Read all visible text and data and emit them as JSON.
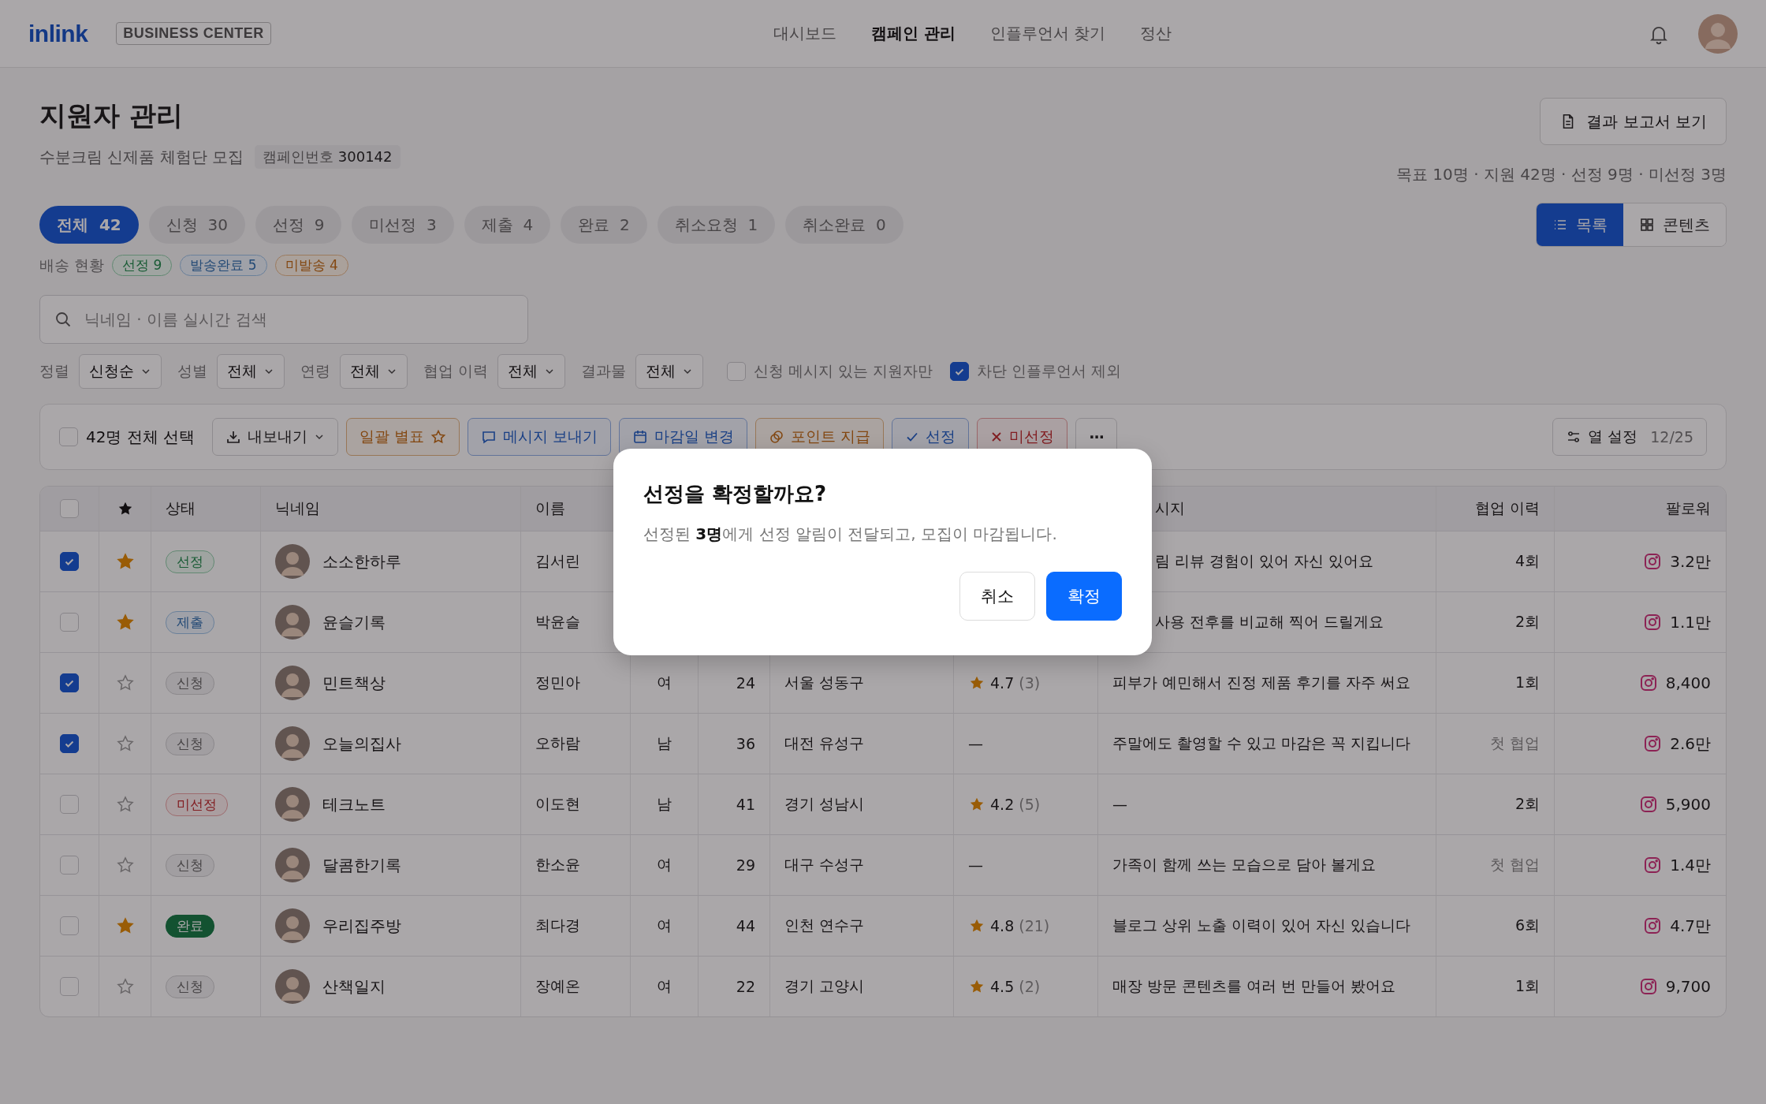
{
  "nav": {
    "logo": "inlink",
    "badge": "BUSINESS CENTER",
    "items": [
      {
        "label": "대시보드",
        "selected": false
      },
      {
        "label": "캠페인 관리",
        "selected": true
      },
      {
        "label": "인플루언서 찾기",
        "selected": false
      },
      {
        "label": "정산",
        "selected": false
      }
    ]
  },
  "header": {
    "title": "지원자 관리",
    "subtitle": "수분크림 신제품 체험단 모집",
    "campaign_tag": "캠페인번호 **300142**",
    "report_button": "결과 보고서 보기",
    "summary": "목표 10명 · 지원 42명 · 선정 9명 · 미선정 3명"
  },
  "tabs": [
    {
      "label": "전체",
      "count": "42",
      "selected": true
    },
    {
      "label": "신청",
      "count": "30",
      "selected": false
    },
    {
      "label": "선정",
      "count": "9",
      "selected": false
    },
    {
      "label": "미선정",
      "count": "3",
      "selected": false
    },
    {
      "label": "제출",
      "count": "4",
      "selected": false
    },
    {
      "label": "완료",
      "count": "2",
      "selected": false
    },
    {
      "label": "취소요청",
      "count": "1",
      "selected": false
    },
    {
      "label": "취소완료",
      "count": "0",
      "selected": false
    }
  ],
  "view_toggle": [
    {
      "label": "목록",
      "selected": true
    },
    {
      "label": "콘텐츠",
      "selected": false
    }
  ],
  "delivery": {
    "label": "배송 현황",
    "tags": [
      {
        "label": "선정 9",
        "kind": "selected"
      },
      {
        "label": "발송완료 5",
        "kind": "shipped"
      },
      {
        "label": "미발송 4",
        "kind": "pending"
      }
    ]
  },
  "search": {
    "placeholder": "닉네임 · 이름 실시간 검색"
  },
  "filters": [
    {
      "label": "정렬",
      "value": "신청순"
    },
    {
      "label": "성별",
      "value": "전체"
    },
    {
      "label": "연령",
      "value": "전체"
    },
    {
      "label": "협업 이력",
      "value": "전체"
    },
    {
      "label": "결과물",
      "value": "전체"
    }
  ],
  "filter_checks": [
    {
      "label": "신청 메시지 있는 지원자만",
      "checked": false
    },
    {
      "label": "차단 인플루언서 제외",
      "checked": true
    }
  ],
  "toolbar": {
    "select_all": {
      "label": "42명 전체 선택",
      "checked": false
    },
    "actions": [
      {
        "label": "내보내기",
        "kind": "neutral"
      },
      {
        "label": "일괄 별표",
        "kind": "warn"
      },
      {
        "label": "메시지 보내기",
        "kind": "primary"
      },
      {
        "label": "마감일 변경",
        "kind": "primary"
      },
      {
        "label": "포인트 지급",
        "kind": "warn"
      },
      {
        "label": "선정",
        "kind": "primary"
      },
      {
        "label": "미선정",
        "kind": "danger"
      },
      {
        "label": "···",
        "kind": "neutral"
      }
    ],
    "columns_button": {
      "label": "열 설정",
      "count": "12/25"
    }
  },
  "table": {
    "header": {
      "checked": false,
      "status": "상태",
      "nickname": "닉네임",
      "name": "이름",
      "message": "시지",
      "collab": "협업 이력",
      "followers": "팔로워"
    },
    "rows": [
      {
        "checked": true,
        "starred": true,
        "status": {
          "label": "선정",
          "kind": "selected"
        },
        "nickname": "소소한하루",
        "name": "김서린",
        "covered": true,
        "message": "림 리뷰 경험이 있어 자신 있어요",
        "collab": {
          "text": "4회",
          "muted": false
        },
        "followers": "3.2만"
      },
      {
        "checked": false,
        "starred": true,
        "status": {
          "label": "제출",
          "kind": "submitted"
        },
        "nickname": "윤슬기록",
        "name": "박윤슬",
        "covered": true,
        "message": "사용 전후를 비교해 찍어 드릴게요",
        "collab": {
          "text": "2회",
          "muted": false
        },
        "followers": "1.1만"
      },
      {
        "checked": true,
        "starred": false,
        "status": {
          "label": "신청",
          "kind": "applied"
        },
        "nickname": "민트책상",
        "name": "정민아",
        "covered": false,
        "gender": "여",
        "age": "24",
        "region": "서울 성동구",
        "rating": {
          "kind": "score",
          "value": "4.7",
          "count": "(3)"
        },
        "message": "피부가 예민해서 진정 제품 후기를 자주 써요",
        "collab": {
          "text": "1회",
          "muted": false
        },
        "followers": "8,400"
      },
      {
        "checked": true,
        "starred": false,
        "status": {
          "label": "신청",
          "kind": "applied"
        },
        "nickname": "오늘의집사",
        "name": "오하람",
        "covered": false,
        "gender": "남",
        "age": "36",
        "region": "대전 유성구",
        "rating": {
          "kind": "none",
          "value": "—"
        },
        "message": "주말에도 촬영할 수 있고 마감은 꼭 지킵니다",
        "collab": {
          "text": "첫 협업",
          "muted": true
        },
        "followers": "2.6만"
      },
      {
        "checked": false,
        "starred": false,
        "status": {
          "label": "미선정",
          "kind": "rejected"
        },
        "nickname": "테크노트",
        "name": "이도현",
        "covered": false,
        "gender": "남",
        "age": "41",
        "region": "경기 성남시",
        "rating": {
          "kind": "score",
          "value": "4.2",
          "count": "(5)"
        },
        "message": "—",
        "collab": {
          "text": "2회",
          "muted": false
        },
        "followers": "5,900"
      },
      {
        "checked": false,
        "starred": false,
        "status": {
          "label": "신청",
          "kind": "applied"
        },
        "nickname": "달콤한기록",
        "name": "한소윤",
        "covered": false,
        "gender": "여",
        "age": "29",
        "region": "대구 수성구",
        "rating": {
          "kind": "none",
          "value": "—"
        },
        "message": "가족이 함께 쓰는 모습으로 담아 볼게요",
        "collab": {
          "text": "첫 협업",
          "muted": true
        },
        "followers": "1.4만"
      },
      {
        "checked": false,
        "starred": true,
        "status": {
          "label": "완료",
          "kind": "done"
        },
        "nickname": "우리집주방",
        "name": "최다경",
        "covered": false,
        "gender": "여",
        "age": "44",
        "region": "인천 연수구",
        "rating": {
          "kind": "score",
          "value": "4.8",
          "count": "(21)"
        },
        "message": "블로그 상위 노출 이력이 있어 자신 있습니다",
        "collab": {
          "text": "6회",
          "muted": false
        },
        "followers": "4.7만"
      },
      {
        "checked": false,
        "starred": false,
        "status": {
          "label": "신청",
          "kind": "applied"
        },
        "nickname": "산책일지",
        "name": "장예온",
        "covered": false,
        "gender": "여",
        "age": "22",
        "region": "경기 고양시",
        "rating": {
          "kind": "score",
          "value": "4.5",
          "count": "(2)"
        },
        "message": "매장 방문 콘텐츠를 여러 번 만들어 봤어요",
        "collab": {
          "text": "1회",
          "muted": false
        },
        "followers": "9,700"
      }
    ]
  },
  "dialog": {
    "title": "선정을 확정할까요?",
    "body": "선정된 **3명**에게 선정 알림이 전달되고, 모집이 마감됩니다.",
    "buttons": [
      {
        "label": "취소",
        "kind": "secondary"
      },
      {
        "label": "확정",
        "kind": "primary"
      }
    ]
  }
}
